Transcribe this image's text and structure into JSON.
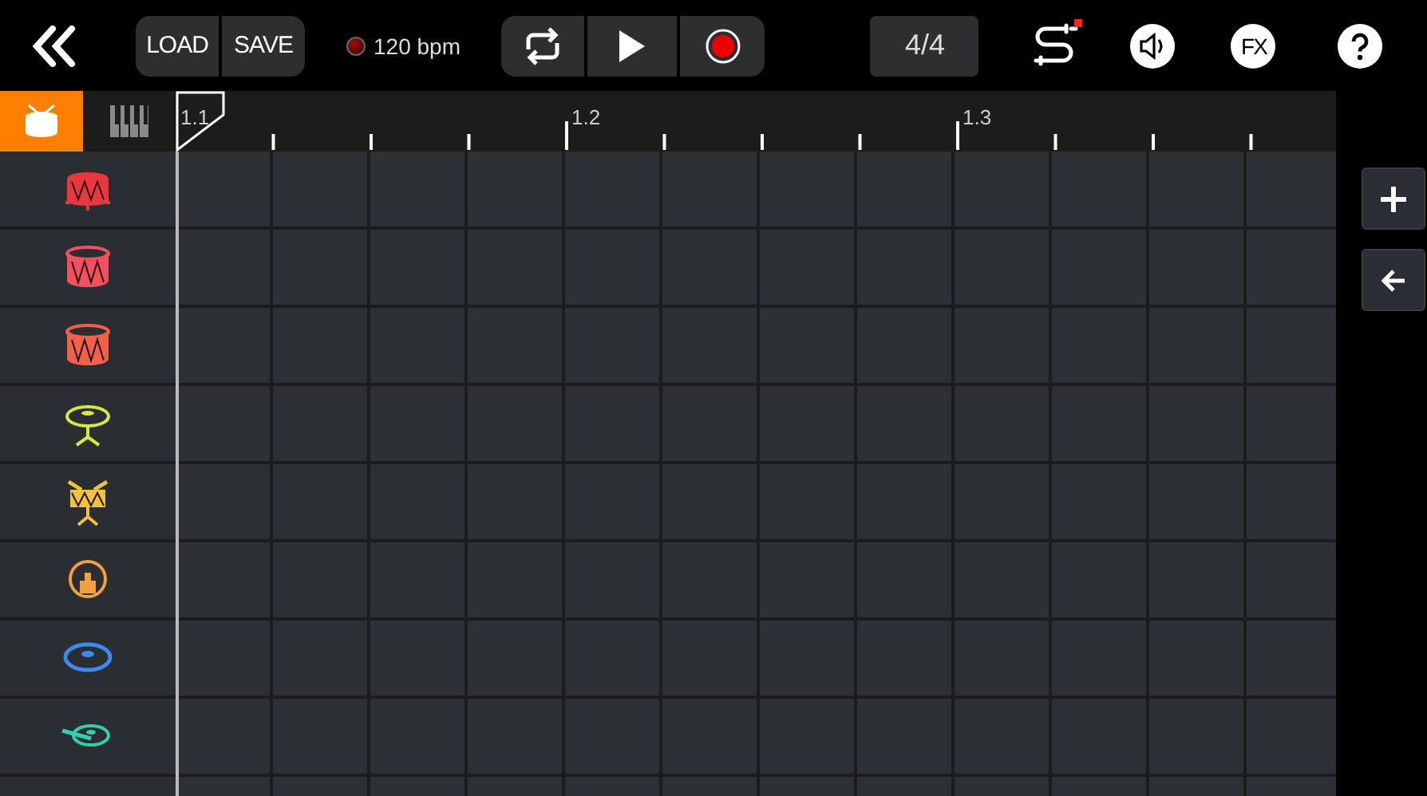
{
  "toolbar": {
    "load_label": "LOAD",
    "save_label": "SAVE",
    "tempo": "120 bpm",
    "time_signature": "4/4",
    "fx_label": "FX",
    "midi_indicator": true
  },
  "instrument_tabs": [
    {
      "kind": "drums",
      "selected": true
    },
    {
      "kind": "piano",
      "selected": false
    }
  ],
  "ruler": {
    "labels": [
      "1.1",
      "1.2",
      "1.3"
    ]
  },
  "tracks": [
    {
      "kind": "tom",
      "color": "#e8373f"
    },
    {
      "kind": "drum",
      "color": "#f2505f"
    },
    {
      "kind": "drum",
      "color": "#f0604a"
    },
    {
      "kind": "cymbal-stand",
      "color": "#d8e83a"
    },
    {
      "kind": "snare",
      "color": "#f0c040"
    },
    {
      "kind": "kick",
      "color": "#f0a040"
    },
    {
      "kind": "cymbal",
      "color": "#3a8af0"
    },
    {
      "kind": "ride",
      "color": "#30d0b0"
    }
  ]
}
